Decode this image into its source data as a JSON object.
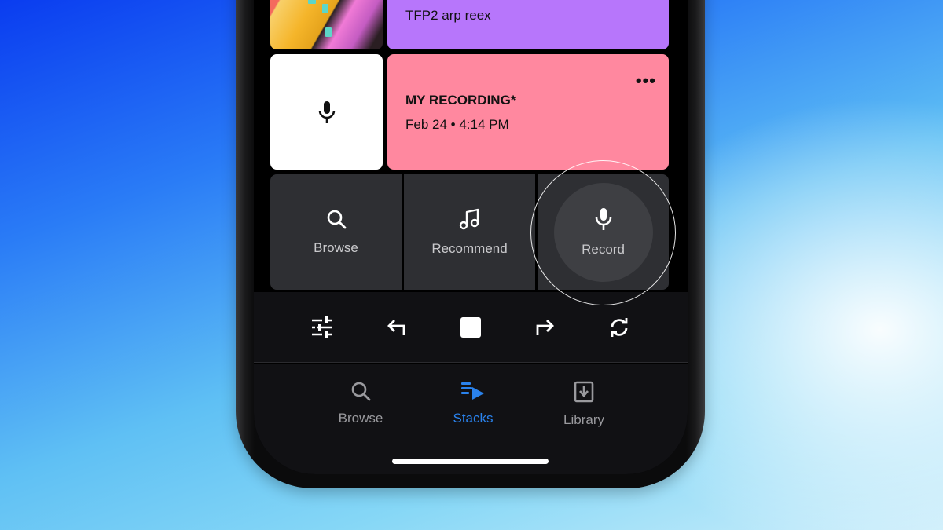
{
  "stack": {
    "items": [
      {
        "title": "TFP2 arp reex",
        "color": "#b776fb",
        "thumbnail": "building-artwork"
      },
      {
        "title": "MY RECORDING*",
        "date": "Feb 24 • 4:14 PM",
        "color": "#ff889f",
        "thumbnail": "microphone-icon",
        "more_label": "•••"
      }
    ]
  },
  "actions": [
    {
      "label": "Browse",
      "icon": "search-icon"
    },
    {
      "label": "Recommend",
      "icon": "music-note-icon"
    },
    {
      "label": "Record",
      "icon": "microphone-icon",
      "highlighted": true
    }
  ],
  "controls": [
    {
      "name": "mixer",
      "icon": "sliders-icon"
    },
    {
      "name": "undo",
      "icon": "undo-arrow-icon"
    },
    {
      "name": "stop",
      "icon": "stop-icon"
    },
    {
      "name": "redo",
      "icon": "redo-arrow-icon"
    },
    {
      "name": "loop",
      "icon": "refresh-icon"
    }
  ],
  "tabbar": {
    "active": "Stacks",
    "accent": "#2a82ec",
    "tabs": [
      {
        "label": "Browse",
        "icon": "search-icon"
      },
      {
        "label": "Stacks",
        "icon": "stacks-play-icon"
      },
      {
        "label": "Library",
        "icon": "download-box-icon"
      }
    ]
  }
}
